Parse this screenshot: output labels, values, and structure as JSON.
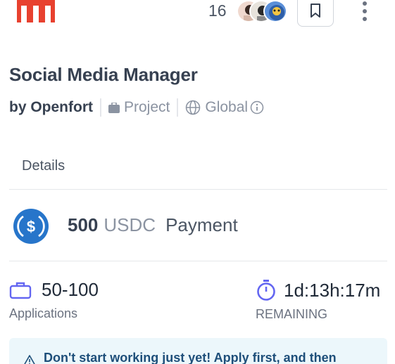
{
  "header": {
    "subscriber_count": "16",
    "icons": {
      "logo": "brand-logo",
      "bookmark": "bookmark-icon",
      "more": "more-vertical-icon"
    }
  },
  "job": {
    "title": "Social Media Manager",
    "by_label": "by Openfort",
    "type_label": "Project",
    "region_label": "Global"
  },
  "tabs": [
    {
      "label": "Details"
    }
  ],
  "payment": {
    "amount": "500",
    "token": "USDC",
    "label": "Payment"
  },
  "stats": {
    "applications": {
      "value": "50-100",
      "label": "Applications"
    },
    "remaining": {
      "value": "1d:13h:17m",
      "label": "REMAINING"
    }
  },
  "notice": {
    "text": "Don't start working just yet! Apply first, and then"
  },
  "colors": {
    "brand_red": "#e8412f",
    "usdc_blue": "#2775ca",
    "accent_indigo": "#6366f1",
    "notice_bg": "#ecf7fb"
  }
}
